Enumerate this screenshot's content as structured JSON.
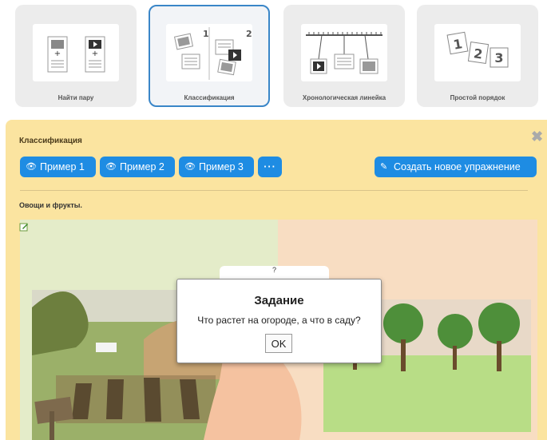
{
  "tiles": [
    {
      "label": "Найти пару",
      "icon": "find-pair-icon"
    },
    {
      "label": "Классификация",
      "icon": "classification-icon",
      "active": true,
      "numbers": [
        "1",
        "2"
      ]
    },
    {
      "label": "Хронологическая линейка",
      "icon": "timeline-icon"
    },
    {
      "label": "Простой порядок",
      "icon": "simple-order-icon",
      "numbers": [
        "1",
        "2",
        "3"
      ]
    }
  ],
  "panel": {
    "title": "Классификация",
    "buttons": {
      "example1": "Пример 1",
      "example2": "Пример 2",
      "example3": "Пример 3",
      "more": "···",
      "create": "Создать новое упражнение"
    },
    "subtitle": "Овощи и фрукты.",
    "popup_back_text": "?"
  },
  "dialog": {
    "title": "Задание",
    "text": "Что растет на огороде, а что в саду?",
    "ok": "OK"
  },
  "colors": {
    "accent": "#1e8ce3",
    "panel_bg": "#fbe4a0",
    "active_border": "#3a86c8"
  },
  "icons": [
    "eye-icon",
    "pencil-icon",
    "close-icon",
    "edit-icon"
  ]
}
